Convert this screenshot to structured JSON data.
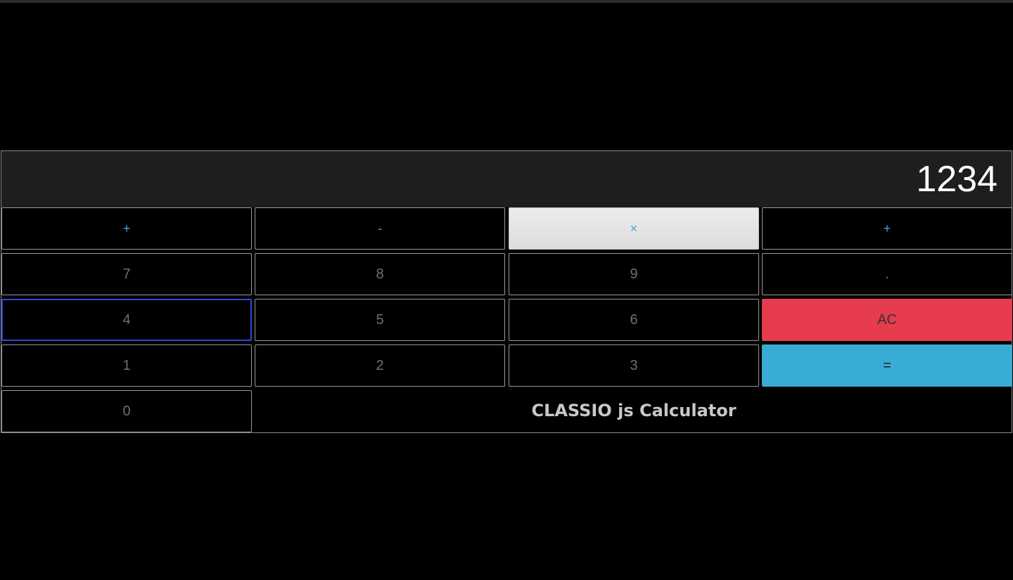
{
  "display": {
    "value": "1234"
  },
  "keys": {
    "add": "+",
    "subtract": "-",
    "multiply": "×",
    "divide": "+",
    "seven": "7",
    "eight": "8",
    "nine": "9",
    "decimal": ".",
    "four": "4",
    "five": "5",
    "six": "6",
    "clear": "AC",
    "one": "1",
    "two": "2",
    "three": "3",
    "equals": "=",
    "zero": "0"
  },
  "brand": {
    "title": "CLASSIO js Calculator"
  },
  "colors": {
    "background": "#000000",
    "display_bg": "#1e1e1e",
    "operator_text": "#3ba9d4",
    "clear_bg": "#e63c4d",
    "equals_bg": "#38acd6",
    "focus_border": "#2f49d9"
  }
}
